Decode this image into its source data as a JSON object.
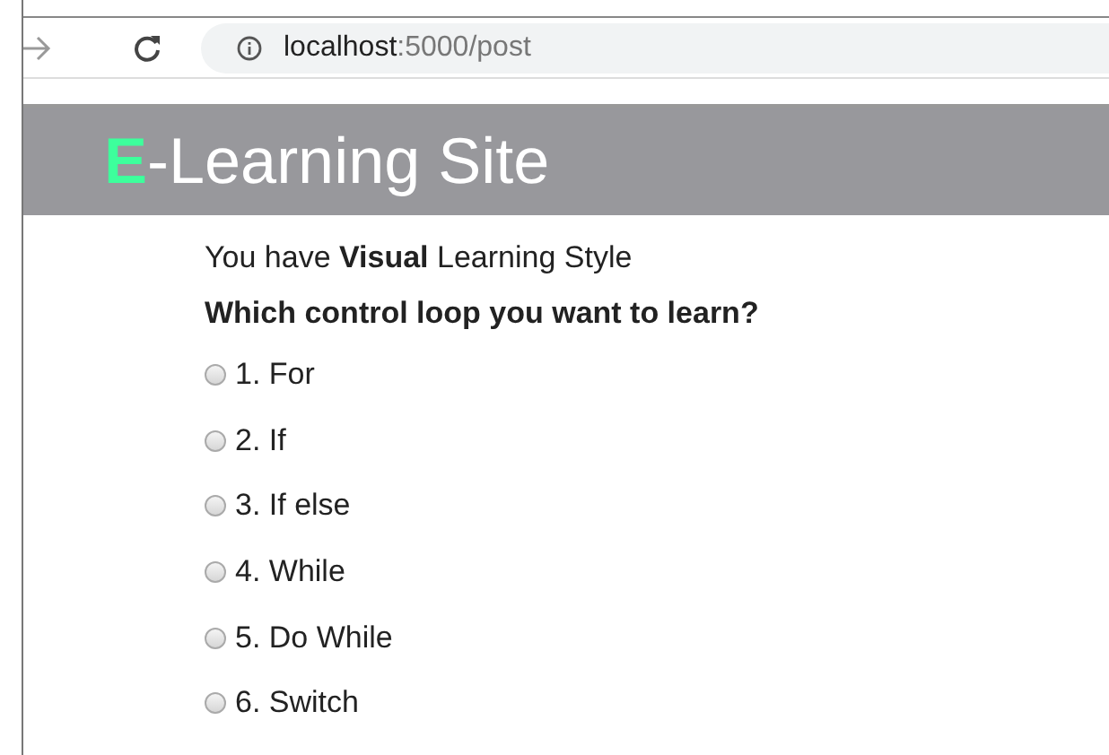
{
  "browser": {
    "url_host": "localhost",
    "url_path": ":5000/post"
  },
  "header": {
    "title_accent": "E",
    "title_rest": "-Learning Site"
  },
  "style_line": "You have **Visual** Learning Style",
  "question": "Which control loop you want to learn?",
  "options": [
    {
      "label": "1. For",
      "checked": false
    },
    {
      "label": "2. If",
      "checked": false
    },
    {
      "label": "3. If else",
      "checked": false
    },
    {
      "label": "4. While",
      "checked": false
    },
    {
      "label": "5. Do While",
      "checked": false
    },
    {
      "label": "6. Switch",
      "checked": false
    }
  ]
}
